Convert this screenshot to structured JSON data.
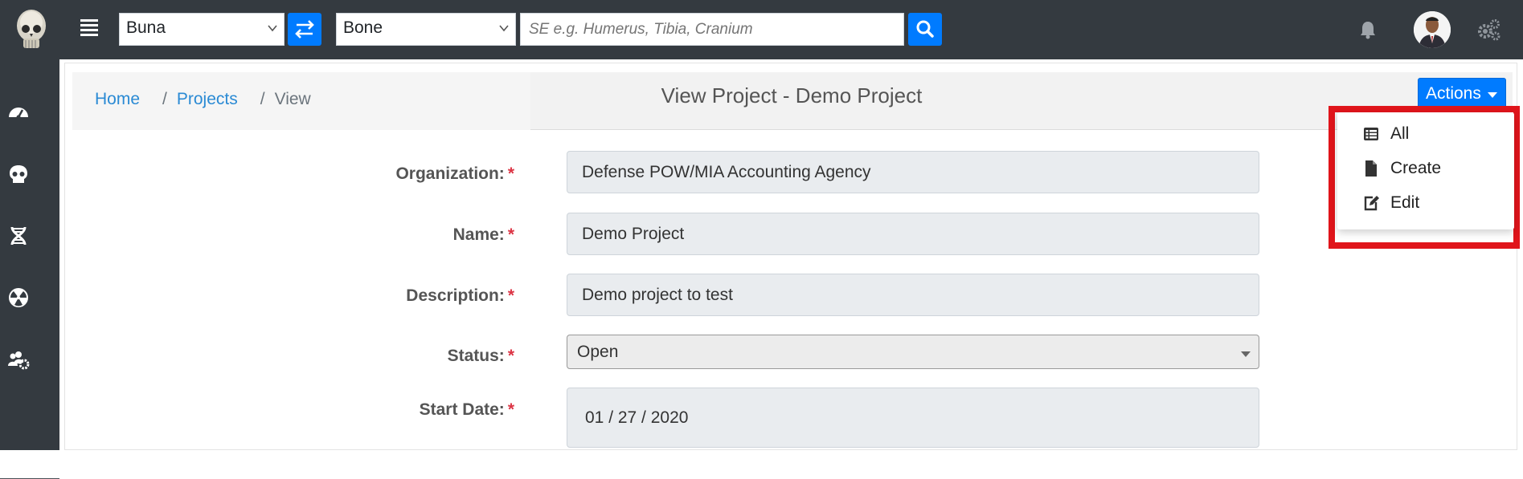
{
  "topbar": {
    "left_select_value": "Buna",
    "right_select_value": "Bone",
    "search_placeholder": "SE e.g. Humerus, Tibia, Cranium"
  },
  "breadcrumb": {
    "home": "Home",
    "projects": "Projects",
    "current": "View",
    "separator": "/"
  },
  "page_title": "View Project - Demo Project",
  "actions": {
    "button_label": "Actions",
    "items": [
      {
        "label": "All",
        "icon": "list-icon"
      },
      {
        "label": "Create",
        "icon": "file-icon"
      },
      {
        "label": "Edit",
        "icon": "edit-icon"
      }
    ]
  },
  "form": {
    "required_marker": "*",
    "organization": {
      "label": "Organization:",
      "value": "Defense POW/MIA Accounting Agency"
    },
    "name": {
      "label": "Name:",
      "value": "Demo Project"
    },
    "description": {
      "label": "Description:",
      "value": "Demo project to test"
    },
    "status": {
      "label": "Status:",
      "value": "Open"
    },
    "start_date": {
      "label": "Start Date:",
      "value": "01 / 27 / 2020"
    }
  },
  "colors": {
    "navbar": "#343a40",
    "primary": "#007bff",
    "highlight": "#e0151b",
    "link": "#2a8ad4"
  }
}
